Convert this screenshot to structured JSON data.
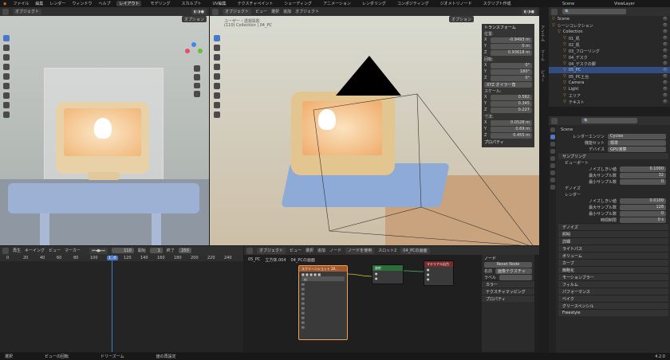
{
  "topbar": {
    "menus": [
      "ファイル",
      "編集",
      "レンダー",
      "ウィンドウ",
      "ヘルプ"
    ],
    "tabs": [
      "レイアウト",
      "モデリング",
      "スカルプト",
      "UV編集",
      "テクスチャペイント",
      "シェーディング",
      "アニメーション",
      "レンダリング",
      "コンポジティング",
      "ジオメトリノード",
      "スクリプト作成"
    ],
    "active_tab": "レイアウト",
    "scene": "Scene",
    "view_layer": "ViewLayer"
  },
  "left_view": {
    "menus": [
      "オブジェクト"
    ],
    "options": "オプション"
  },
  "main_view": {
    "menus": [
      "オブジェクト",
      "ビュー",
      "選択",
      "追加",
      "オブジェクト"
    ],
    "info1": "ユーザー・透視投影",
    "info2": "(110) Collection | 04_PC",
    "options": "オプション"
  },
  "npanel": {
    "header": "トランスフォーム",
    "loc_label": "位置:",
    "loc": [
      [
        "X",
        "-0.9493 m"
      ],
      [
        "Y",
        "0 m"
      ],
      [
        "Z",
        "0.93618 m"
      ]
    ],
    "rot_label": "回転:",
    "rot": [
      [
        "X",
        "0°"
      ],
      [
        "Y",
        "180°"
      ],
      [
        "Z",
        "0°"
      ]
    ],
    "mode": "XYZ オイラー角",
    "scale_label": "スケール:",
    "scale": [
      [
        "X",
        "0.582"
      ],
      [
        "Y",
        "0.345"
      ],
      [
        "Z",
        "0.227"
      ]
    ],
    "dim_label": "寸法:",
    "dim": [
      [
        "X",
        "0.0528 m"
      ],
      [
        "Y",
        "0.69 m"
      ],
      [
        "Z",
        "0.455 m"
      ]
    ],
    "props": "プロパティ",
    "vtabs": [
      "アイテム",
      "ツール",
      "ビュー"
    ]
  },
  "outliner": {
    "items": [
      {
        "name": "Scene",
        "level": 0
      },
      {
        "name": "シーンコレクション",
        "level": 0
      },
      {
        "name": "Collection",
        "level": 1
      },
      {
        "name": "01_机",
        "level": 2
      },
      {
        "name": "02_机",
        "level": 2
      },
      {
        "name": "03_フローリング",
        "level": 2
      },
      {
        "name": "04_デスク",
        "level": 2
      },
      {
        "name": "04_デスクの脚",
        "level": 2
      },
      {
        "name": "05_PC",
        "level": 2
      },
      {
        "name": "05_PC土台",
        "level": 2
      },
      {
        "name": "Camera",
        "level": 2
      },
      {
        "name": "Light",
        "level": 2
      },
      {
        "name": "エリア",
        "level": 2
      },
      {
        "name": "テキスト",
        "level": 2
      }
    ],
    "selected": "05_PC"
  },
  "properties": {
    "scene": "Scene",
    "engine_label": "レンダーエンジン",
    "engine": "Cycles",
    "feature_label": "機能セット",
    "feature": "標準",
    "device_label": "デバイス",
    "device": "GPU演算",
    "sampling": "サンプリング",
    "viewport": "ビューポート",
    "noise_th": "ノイズしきい値",
    "noise_val": "0.1000",
    "max_s": "最大サンプル数",
    "max_val": "32",
    "min_s": "最小サンプル数",
    "min_val": "0",
    "denoise": "デノイズ",
    "render": "レンダー",
    "r_noise_val": "0.0100",
    "r_max_val": "128",
    "r_min_val": "0",
    "time_limit": "時間制限",
    "time_val": "0 s",
    "sections": [
      "デノイズ",
      "照明",
      "詳細",
      "ライトパス",
      "ボリューム",
      "カーブ",
      "簡略化",
      "モーションブラー",
      "フィルム",
      "パフォーマンス",
      "ベイク",
      "グリースペンシル",
      "Freestyle"
    ]
  },
  "timeline": {
    "menus": [
      "再生",
      "キーイング",
      "ビュー",
      "マーカー"
    ],
    "frame": "110",
    "start_label": "開始",
    "start": "1",
    "end_label": "終了",
    "end": "250",
    "ticks": [
      "0",
      "20",
      "40",
      "60",
      "80",
      "100",
      "110",
      "120",
      "140",
      "160",
      "180",
      "200",
      "220",
      "240"
    ],
    "current": "110"
  },
  "node_editor": {
    "menus": [
      "オブジェクト",
      "ビュー",
      "選択",
      "追加",
      "ノード",
      "ノードを使用"
    ],
    "slot": "スロット2",
    "material": "04_PCの画面",
    "breadcrumb": [
      "05_PC",
      "立方体.004",
      "04_PCの画面"
    ],
    "img_node": "スクリーンショット 20...",
    "out_node": "マテリアル出力",
    "emit_node": "放射",
    "side_header": "ノード",
    "reset": "Reset Node",
    "name_label": "名前",
    "name_val": "画像テクスチャ",
    "label_label": "ラベル",
    "color_sec": "カラー",
    "tex_map": "テクスチャマッピング",
    "props": "プロパティ"
  },
  "statusbar": {
    "left": "選択",
    "mid1": "ビューの回転",
    "mid2": "ドリーズーム",
    "mid3": "値の再設定",
    "version": "4.2.0"
  }
}
